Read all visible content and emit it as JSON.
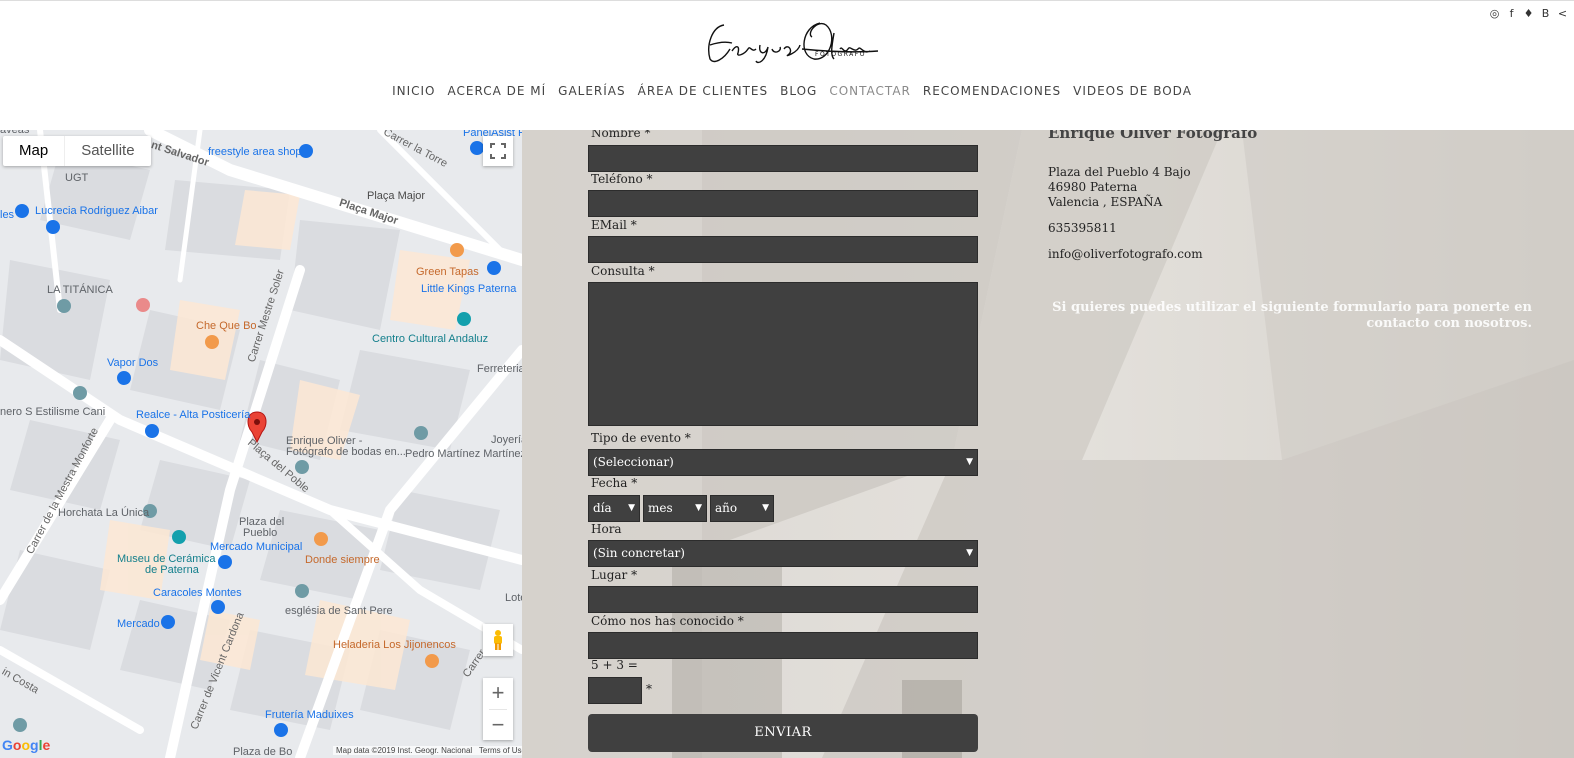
{
  "header": {
    "logo_text": "Enrique Oliver",
    "logo_sub": "FOTOGRAFO",
    "social": [
      {
        "icon": "instagram-icon",
        "glyph": "◎"
      },
      {
        "icon": "facebook-icon",
        "glyph": "f"
      },
      {
        "icon": "twitter-icon",
        "glyph": "♦"
      },
      {
        "icon": "blogger-icon",
        "glyph": "B"
      },
      {
        "icon": "share-icon",
        "glyph": "<"
      }
    ],
    "nav": [
      "INICIO",
      "ACERCA DE MÍ",
      "GALERÍAS",
      "ÁREA DE CLIENTES",
      "BLOG",
      "CONTACTAR",
      "RECOMENDACIONES",
      "VIDEOS DE BODA"
    ],
    "nav_active": "CONTACTAR"
  },
  "map": {
    "type_map": "Map",
    "type_satellite": "Satellite",
    "zoom_in": "+",
    "zoom_out": "−",
    "google": "Google",
    "attribution": "Map data ©2019 Inst. Geogr. Nacional",
    "terms": "Terms of Use",
    "labels": {
      "l1": "aveas",
      "l2": "nt Salvador",
      "l3": "freestyle area shop",
      "l4": "PanelAsist P",
      "l5": "Carrer la Torre",
      "l6": "UGT",
      "l7": "Plaça Major",
      "l8": "Plaça Major",
      "l9": "Lucrecia Rodriguez Aibar",
      "l10": "les",
      "l11": "Green Tapas",
      "l12": "Little Kings Paterna",
      "l13": "LA TITÁNICA",
      "l14": "Carrer Mestre Soler",
      "l15": "Che Que Bo",
      "l16": "Centro Cultural Andaluz",
      "l17": "Vapor Dos",
      "l18": "Ferreteria",
      "l19": "nero S Estilisme Cani",
      "l20": "Realce - Alta Posticería",
      "l21": "Enrique Oliver -",
      "l22": "Fotógrafo de bodas en...",
      "l23": "Joyería",
      "l24": "Pedro Martínez Martínez",
      "l25": "Plaça del Poble",
      "l26": "Carrer de la Mestra Monforte",
      "l27": "Horchata La Única",
      "l28": "Plaza del",
      "l29": "Pueblo",
      "l30": "Museu de Cerámica",
      "l31": "de Paterna",
      "l32": "Mercado Municipal",
      "l33": "Donde siempre",
      "l34": "Caracoles Montes",
      "l35": "Lote",
      "l36": "Mercado",
      "l37": "església de Sant Pere",
      "l38": "Heladeria Los Jijonencos",
      "l39": "Carrer de Vicent Cardona",
      "l40": "in Costa",
      "l41": "Frutería Maduixes",
      "l42": "Plaza de Bo",
      "l43": "Carrer d..."
    }
  },
  "form": {
    "nombre": "Nombre *",
    "telefono": "Teléfono *",
    "email": "EMail *",
    "consulta": "Consulta *",
    "tipo_evento": "Tipo de evento *",
    "tipo_evento_value": "(Seleccionar)",
    "fecha": "Fecha *",
    "dia": "día",
    "mes": "mes",
    "anio": "año",
    "hora": "Hora",
    "hora_value": "(Sin concretar)",
    "lugar": "Lugar *",
    "como": "Cómo nos has conocido *",
    "captcha": "5 + 3 =",
    "captcha_req": "*",
    "submit": "ENVIAR"
  },
  "info": {
    "title": "Enrique Oliver Fotografo",
    "address1": "Plaza del Pueblo 4 Bajo",
    "address2": "46980 Paterna",
    "address3": "Valencia , ESPAÑA",
    "phone": "635395811",
    "email": "info@oliverfotografo.com",
    "note": "Si quieres puedes utilizar el siguiente formulario para ponerte en contacto con nosotros."
  },
  "colors": {
    "field_bg": "#404040",
    "pin": "#ea4335",
    "poi_blue": "#1a73e8",
    "poi_orange": "#f29a4b",
    "poi_teal": "#13a0ad"
  }
}
